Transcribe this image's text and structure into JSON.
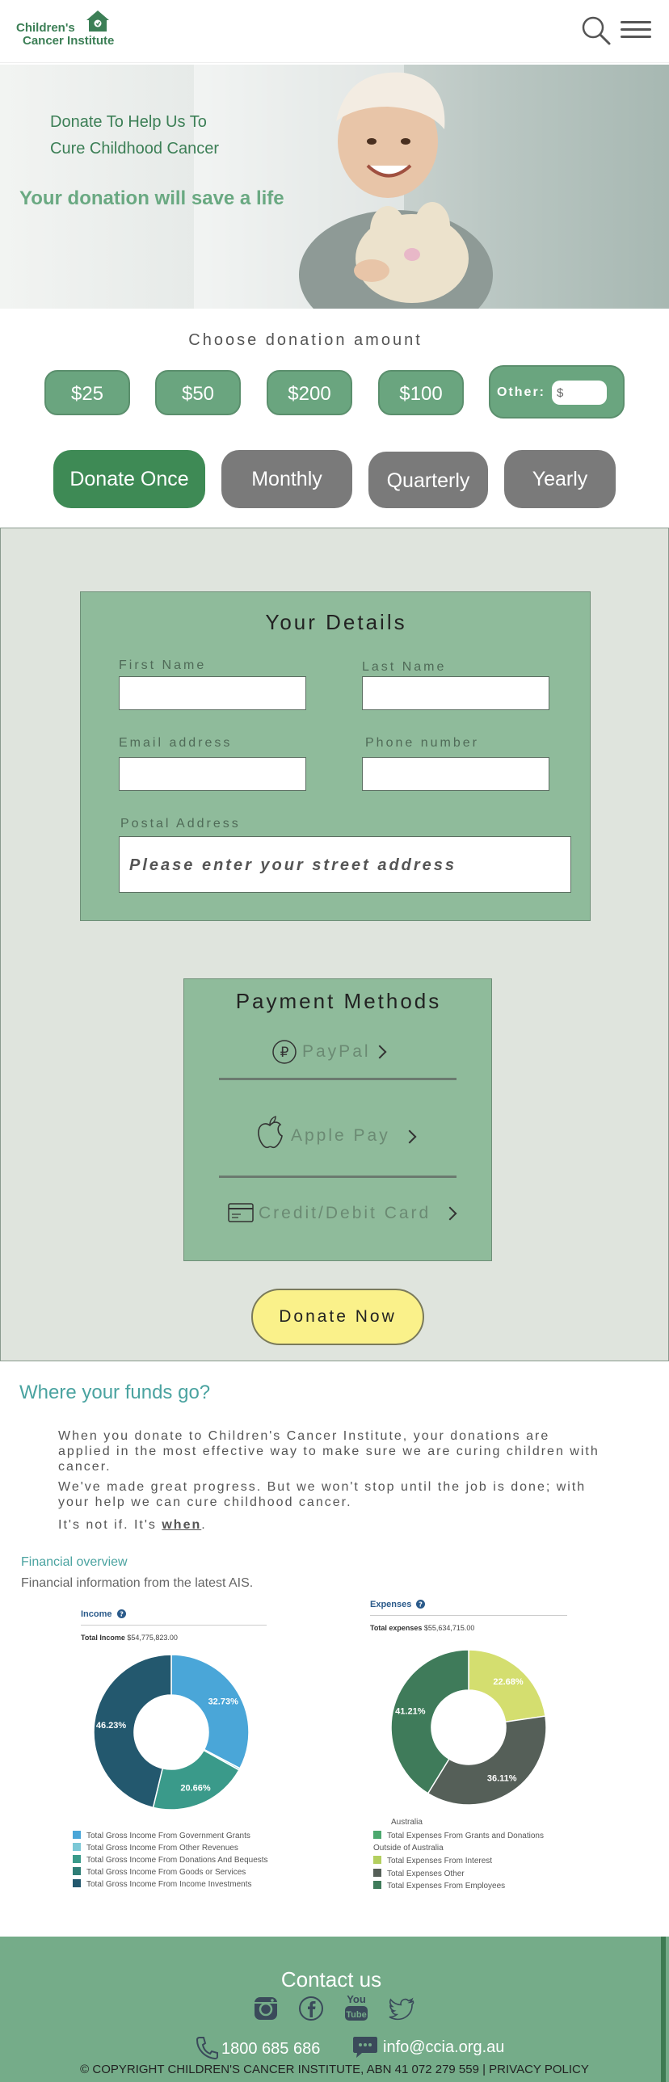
{
  "header": {
    "logo_line1": "Children's",
    "logo_line2": "Cancer Institute",
    "search_icon": "search-icon",
    "menu_icon": "hamburger-menu-icon"
  },
  "hero": {
    "title_line1": "Donate To Help Us To",
    "title_line2": "Cure Childhood Cancer",
    "tagline": "Your donation will save a life"
  },
  "amount": {
    "title": "Choose donation amount",
    "options": [
      "$25",
      "$50",
      "$200",
      "$100"
    ],
    "other_label": "Other:",
    "other_value": "$"
  },
  "frequency": {
    "options": [
      "Donate Once",
      "Monthly",
      "Quarterly",
      "Yearly"
    ],
    "selected": "Donate Once"
  },
  "details": {
    "title": "Your Details",
    "first_name_label": "First Name",
    "last_name_label": "Last Name",
    "email_label": "Email address",
    "phone_label": "Phone number",
    "address_label": "Postal Address",
    "address_placeholder": "Please enter your street address"
  },
  "payment": {
    "title": "Payment Methods",
    "methods": [
      {
        "label": "PayPal",
        "icon": "paypal-icon"
      },
      {
        "label": "Apple Pay",
        "icon": "apple-icon"
      },
      {
        "label": "Credit/Debit Card",
        "icon": "credit-card-icon"
      }
    ]
  },
  "donate_button": "Donate Now",
  "funds": {
    "title": "Where your funds go?",
    "para1": "When you donate to Children's Cancer Institute, your donations are applied in the most effective way to make sure we are curing children with cancer.",
    "para2": "We've made great progress. But we won't stop until the job is done; with your help we can cure childhood cancer.",
    "para3_prefix": "It's not if. It's ",
    "para3_link": "when",
    "para3_suffix": ".",
    "financial_title": "Financial overview",
    "financial_sub": "Financial information from the latest AIS."
  },
  "income_card": {
    "title": "Income",
    "total_label": "Total Income",
    "total_value": "$54,775,823.00"
  },
  "expenses_card": {
    "title": "Expenses",
    "total_label": "Total expenses",
    "total_value": "$55,634,715.00"
  },
  "chart_data": [
    {
      "type": "pie",
      "title": "Income",
      "slices": [
        {
          "label": "Total Gross Income From Government Grants",
          "value": 32.73,
          "color": "#4aa6d8"
        },
        {
          "label": "Total Gross Income From Other Revenues",
          "value": 0.38,
          "color": "#7cc8d6"
        },
        {
          "label": "Total Gross Income From Donations And Bequests",
          "value": 20.66,
          "color": "#3a9a8a"
        },
        {
          "label": "Total Gross Income From Goods or Services",
          "value": 0.0,
          "color": "#2e7d76"
        },
        {
          "label": "Total Gross Income From Income Investments",
          "value": 46.23,
          "color": "#23586e"
        }
      ],
      "labels_shown": [
        "32.73%",
        "20.66%",
        "46.23%"
      ]
    },
    {
      "type": "pie",
      "title": "Expenses",
      "slices": [
        {
          "label": "Total Expenses From Interest",
          "value": 22.68,
          "color": "#d4de6f"
        },
        {
          "label": "Total Expenses Other",
          "value": 36.11,
          "color": "#555f58"
        },
        {
          "label": "Total Expenses From Employees",
          "value": 41.21,
          "color": "#3f7b5a"
        }
      ],
      "labels_shown": [
        "22.68%",
        "36.11%",
        "41.21%"
      ]
    }
  ],
  "income_legend": [
    {
      "label": "Total Gross Income From Government Grants",
      "color": "#4aa6d8"
    },
    {
      "label": "Total Gross Income From Other Revenues",
      "color": "#7cc8d6"
    },
    {
      "label": "Total Gross Income From Donations And Bequests",
      "color": "#3a9a8a"
    },
    {
      "label": "Total Gross Income From Goods or Services",
      "color": "#2e7d76"
    },
    {
      "label": "Total Gross Income From Income Investments",
      "color": "#23586e"
    }
  ],
  "expenses_legend": {
    "pre_text": "Australia",
    "items": [
      {
        "label": "Total Expenses From Grants and Donations",
        "color": "#4ca86e"
      },
      {
        "label": "Outside of Australia",
        "color": null
      },
      {
        "label": "Total Expenses From Interest",
        "color": "#b3cf5f"
      },
      {
        "label": "Total Expenses Other",
        "color": "#555f58"
      },
      {
        "label": "Total Expenses From Employees",
        "color": "#3f7b5a"
      }
    ]
  },
  "footer": {
    "title": "Contact us",
    "social": [
      "instagram-icon",
      "facebook-icon",
      "youtube-icon",
      "twitter-icon"
    ],
    "youtube_text_1": "You",
    "youtube_text_2": "Tube",
    "phone": "1800 685 686",
    "email": "info@ccia.org.au",
    "copyright": "© COPYRIGHT CHILDREN'S CANCER INSTITUTE, ABN 41 072 279 559 | PRIVACY POLICY"
  }
}
